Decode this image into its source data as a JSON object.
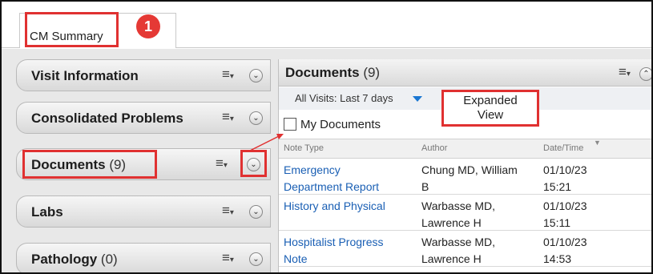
{
  "tabbar": {
    "active_tab": "CM Summary",
    "step_number": "1"
  },
  "left_components": [
    {
      "title": "Visit Information",
      "count": ""
    },
    {
      "title": "Consolidated Problems",
      "count": ""
    },
    {
      "title": "Documents",
      "count": "(9)"
    },
    {
      "title": "Labs",
      "count": ""
    },
    {
      "title": "Pathology",
      "count": "(0)"
    }
  ],
  "icons": {
    "menu": "hamburger-dropdown-icon",
    "toggle_collapsed": "chevron-down-circle-icon",
    "toggle_expanded": "chevron-up-circle-icon",
    "sort": "sort-descending-icon",
    "filter": "dropdown-arrow-icon"
  },
  "glyphs": {
    "menu": "≡",
    "menu_caret": "▾",
    "down": "⌄",
    "up": "⌃",
    "sort": "▼"
  },
  "panel": {
    "title": "Documents",
    "count": "(9)",
    "filter_label": "All Visits: Last 7 days",
    "my_documents_label": "My Documents",
    "callout_line1": "Expanded",
    "callout_line2": "View",
    "columns": {
      "type": "Note Type",
      "author": "Author",
      "date": "Date/Time"
    },
    "rows": [
      {
        "type_line1": "Emergency",
        "type_line2": "Department Report",
        "author_line1": "Chung MD, William",
        "author_line2": "B",
        "date_line1": "01/10/23",
        "date_line2": "15:21"
      },
      {
        "type_line1": "History and Physical",
        "type_line2": "",
        "author_line1": "Warbasse MD,",
        "author_line2": "Lawrence H",
        "date_line1": "01/10/23",
        "date_line2": "15:11"
      },
      {
        "type_line1": "Hospitalist Progress",
        "type_line2": "Note",
        "author_line1": "Warbasse MD,",
        "author_line2": "Lawrence H",
        "date_line1": "01/10/23",
        "date_line2": "14:53"
      }
    ]
  },
  "colors": {
    "highlight": "#e03131",
    "link": "#1a5fb4",
    "badge": "#e53935"
  }
}
